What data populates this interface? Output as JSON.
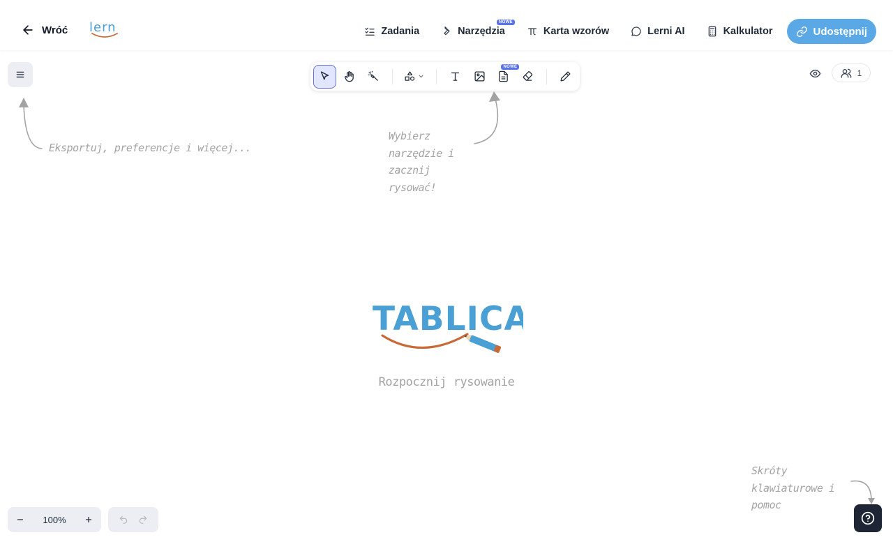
{
  "header": {
    "back_label": "Wróć",
    "logo_text": "lern",
    "nav": [
      {
        "label": "Zadania",
        "icon": "checklist-icon"
      },
      {
        "label": "Narzędzia",
        "icon": "wrench-icon",
        "badge": "NOWE"
      },
      {
        "label": "Karta wzorów",
        "icon": "pi-icon"
      },
      {
        "label": "Lerni AI",
        "icon": "chat-bubble-icon"
      },
      {
        "label": "Kalkulator",
        "icon": "calculator-icon"
      }
    ],
    "share_label": "Udostępnij"
  },
  "toolbar": {
    "tools": [
      "select-arrow-icon",
      "hand-icon",
      "laser-pointer-icon",
      "shapes-icon",
      "text-icon",
      "image-icon",
      "document-icon",
      "eraser-icon",
      "pencil-icon"
    ],
    "document_badge": "NOWE"
  },
  "top_right": {
    "users_count": "1"
  },
  "hints": {
    "menu_hint": "Eksportuj, preferencje i więcej...",
    "toolbar_hint": [
      "Wybierz",
      "narzędzie i",
      "zacznij",
      "rysować!"
    ],
    "help_hint": [
      "Skróty",
      "klawiaturowe i",
      "pomoc"
    ]
  },
  "center": {
    "logo_text": "TABLICA",
    "subtitle": "Rozpocznij rysowanie"
  },
  "zoom": {
    "level": "100%"
  },
  "colors": {
    "accent": "#5aa8e6",
    "logo_blue": "#4a9fd4",
    "logo_orange": "#c8693a",
    "active_tool": "#6470e0",
    "help_bg": "#1e2636"
  }
}
